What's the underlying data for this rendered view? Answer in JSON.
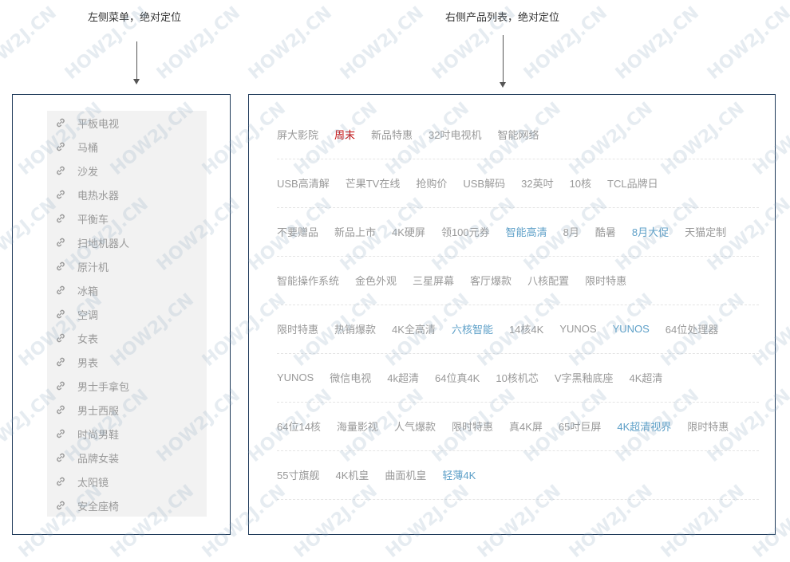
{
  "annotations": {
    "left_label": "左侧菜单，绝对定位",
    "right_label": "右侧产品列表，绝对定位"
  },
  "menu": {
    "items": [
      {
        "label": "平板电视"
      },
      {
        "label": "马桶"
      },
      {
        "label": "沙发"
      },
      {
        "label": "电热水器"
      },
      {
        "label": "平衡车"
      },
      {
        "label": "扫地机器人"
      },
      {
        "label": "原汁机"
      },
      {
        "label": "冰箱"
      },
      {
        "label": "空调"
      },
      {
        "label": "女表"
      },
      {
        "label": "男表"
      },
      {
        "label": "男士手拿包"
      },
      {
        "label": "男士西服"
      },
      {
        "label": "时尚男鞋"
      },
      {
        "label": "品牌女装"
      },
      {
        "label": "太阳镜"
      },
      {
        "label": "安全座椅"
      }
    ]
  },
  "products": {
    "rows": [
      [
        {
          "t": "屏大影院"
        },
        {
          "t": "周末",
          "c": "red"
        },
        {
          "t": "新品特惠"
        },
        {
          "t": "32吋电视机"
        },
        {
          "t": "智能网络"
        }
      ],
      [
        {
          "t": "USB高清解"
        },
        {
          "t": "芒果TV在线"
        },
        {
          "t": "抢购价"
        },
        {
          "t": "USB解码"
        },
        {
          "t": "32英吋"
        },
        {
          "t": "10核"
        },
        {
          "t": "TCL品牌日"
        }
      ],
      [
        {
          "t": "不要赠品"
        },
        {
          "t": "新品上市"
        },
        {
          "t": "4K硬屏"
        },
        {
          "t": "领100元券"
        },
        {
          "t": "智能高清",
          "c": "blue"
        },
        {
          "t": "8月"
        },
        {
          "t": "酷暑"
        },
        {
          "t": "8月大促",
          "c": "blue"
        },
        {
          "t": "天猫定制"
        }
      ],
      [
        {
          "t": "智能操作系统"
        },
        {
          "t": "金色外观"
        },
        {
          "t": "三星屏幕"
        },
        {
          "t": "客厅爆款"
        },
        {
          "t": "八核配置"
        },
        {
          "t": "限时特惠"
        }
      ],
      [
        {
          "t": "限时特惠"
        },
        {
          "t": "热销爆款"
        },
        {
          "t": "4K全高清"
        },
        {
          "t": "六核智能",
          "c": "blue"
        },
        {
          "t": "14核4K"
        },
        {
          "t": "YUNOS"
        },
        {
          "t": "YUNOS",
          "c": "blue"
        },
        {
          "t": "64位处理器"
        }
      ],
      [
        {
          "t": "YUNOS"
        },
        {
          "t": "微信电视"
        },
        {
          "t": "4k超清"
        },
        {
          "t": "64位真4K"
        },
        {
          "t": "10核机芯"
        },
        {
          "t": "V字黑釉底座"
        },
        {
          "t": "4K超清"
        }
      ],
      [
        {
          "t": "64位14核"
        },
        {
          "t": "海量影视"
        },
        {
          "t": "人气爆款"
        },
        {
          "t": "限时特惠"
        },
        {
          "t": "真4K屏"
        },
        {
          "t": "65吋巨屏"
        },
        {
          "t": "4K超清视界",
          "c": "blue"
        },
        {
          "t": "限时特惠"
        }
      ],
      [
        {
          "t": "55寸旗舰"
        },
        {
          "t": "4K机皇"
        },
        {
          "t": "曲面机皇"
        },
        {
          "t": "轻薄4K",
          "c": "blue"
        }
      ]
    ]
  },
  "watermark": {
    "text": "HOW2J.CN"
  }
}
